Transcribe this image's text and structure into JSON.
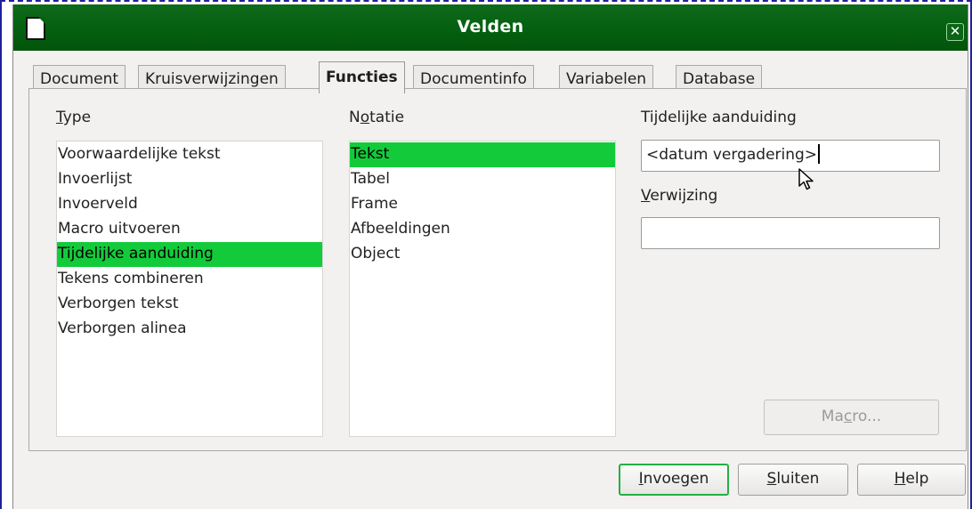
{
  "window": {
    "title": "Velden"
  },
  "tabs": [
    {
      "label": "Document"
    },
    {
      "label": "Kruisverwijzingen"
    },
    {
      "label": "Functies"
    },
    {
      "label": "Documentinfo"
    },
    {
      "label": "Variabelen"
    },
    {
      "label": "Database"
    }
  ],
  "active_tab": "Functies",
  "type_column": {
    "label_mnemonic": "T",
    "label_rest": "ype",
    "items": [
      "Voorwaardelijke tekst",
      "Invoerlijst",
      "Invoerveld",
      "Macro uitvoeren",
      "Tijdelijke aanduiding",
      "Tekens combineren",
      "Verborgen tekst",
      "Verborgen alinea"
    ],
    "selected": "Tijdelijke aanduiding"
  },
  "notatie_column": {
    "label_pre": "N",
    "label_mnemonic": "o",
    "label_rest": "tatie",
    "items": [
      "Tekst",
      "Tabel",
      "Frame",
      "Afbeeldingen",
      "Object"
    ],
    "selected": "Tekst"
  },
  "placeholder_field": {
    "label": "Tijdelijke aanduiding",
    "value": "<datum vergadering>"
  },
  "reference_field": {
    "label_mnemonic": "V",
    "label_rest": "erwijzing",
    "value": ""
  },
  "buttons": {
    "macro_pre": "Ma",
    "macro_mnemonic": "c",
    "macro_rest": "ro...",
    "insert_mnemonic": "I",
    "insert_rest": "nvoegen",
    "close_mnemonic": "S",
    "close_rest": "luiten",
    "help_mnemonic": "H",
    "help_rest": "elp"
  },
  "icons": {
    "app": "document-icon",
    "close": "close-icon",
    "cursor": "mouse-pointer-icon"
  },
  "colors": {
    "titlebar": "#046010",
    "selection": "#13cb3a",
    "default_button_border": "#23b043"
  }
}
